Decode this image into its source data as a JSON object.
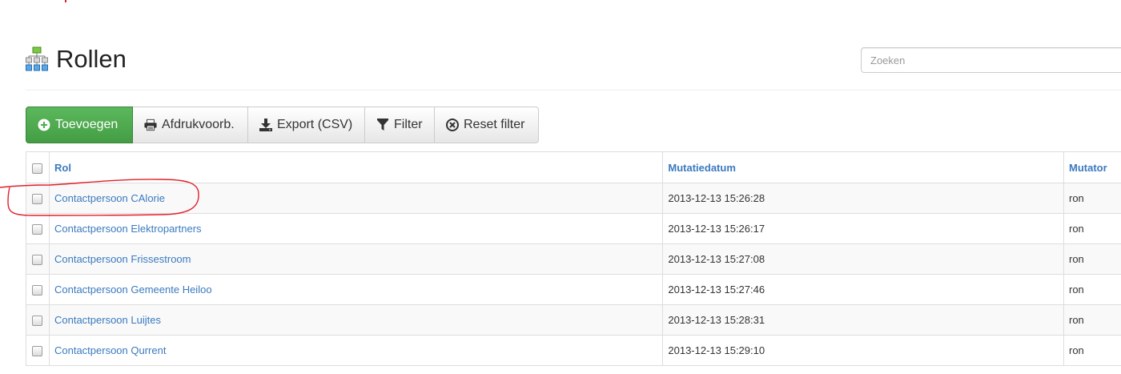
{
  "header": {
    "title": "Rollen",
    "icon": "org-chart-icon"
  },
  "search": {
    "placeholder": "Zoeken",
    "value": ""
  },
  "toolbar": {
    "add_label": "Toevoegen",
    "print_label": "Afdrukvoorb.",
    "export_label": "Export (CSV)",
    "filter_label": "Filter",
    "reset_label": "Reset filter"
  },
  "table": {
    "headers": {
      "rol": "Rol",
      "date": "Mutatiedatum",
      "mutator": "Mutator"
    },
    "rows": [
      {
        "rol": "Contactpersoon CAlorie",
        "date": "2013-12-13 15:26:28",
        "mutator": "ron"
      },
      {
        "rol": "Contactpersoon Elektropartners",
        "date": "2013-12-13 15:26:17",
        "mutator": "ron"
      },
      {
        "rol": "Contactpersoon Frissestroom",
        "date": "2013-12-13 15:27:08",
        "mutator": "ron"
      },
      {
        "rol": "Contactpersoon Gemeente Heiloo",
        "date": "2013-12-13 15:27:46",
        "mutator": "ron"
      },
      {
        "rol": "Contactpersoon Luijtes",
        "date": "2013-12-13 15:28:31",
        "mutator": "ron"
      },
      {
        "rol": "Contactpersoon Qurrent",
        "date": "2013-12-13 15:29:10",
        "mutator": "ron"
      }
    ]
  },
  "colors": {
    "link": "#3a7abf",
    "primary_button": "#5cb85c",
    "annotation": "#e0202a"
  }
}
